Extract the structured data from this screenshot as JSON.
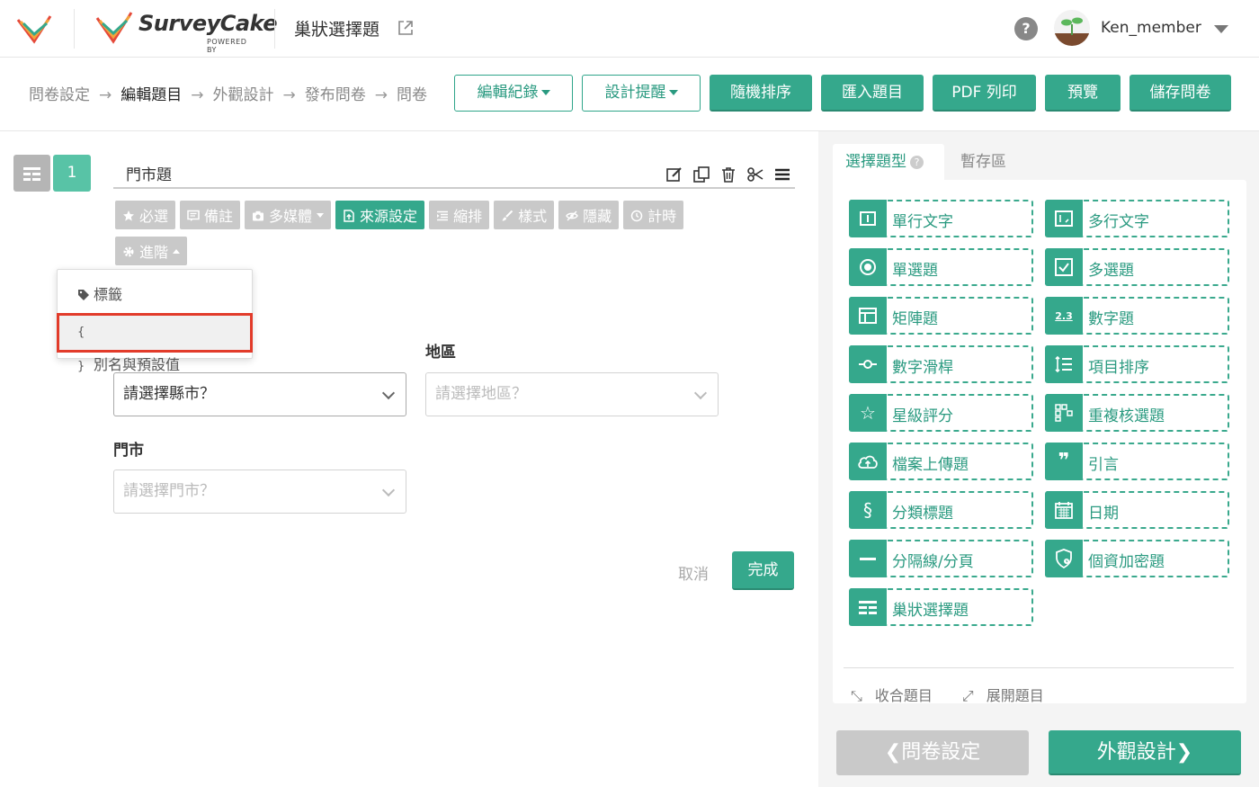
{
  "header": {
    "brand_name": "SurveyCake",
    "brand_powered": "POWERED BY",
    "survey_title": "巢狀選擇題",
    "help_symbol": "?",
    "username": "Ken_member"
  },
  "breadcrumbs": [
    "問卷設定",
    "編輯題目",
    "外觀設計",
    "發布問卷",
    "問卷"
  ],
  "breadcrumb_arrow": "→",
  "toolbar": {
    "edit_log": "編輯紀錄",
    "design_tips": "設計提醒",
    "random_order": "隨機排序",
    "import_questions": "匯入題目",
    "pdf_print": "PDF 列印",
    "preview": "預覽",
    "save_survey": "儲存問卷"
  },
  "question": {
    "number": "1",
    "title": "門市題",
    "options": [
      {
        "label": "必選",
        "icon": "star-icon",
        "active": false
      },
      {
        "label": "備註",
        "icon": "comment-icon",
        "active": false
      },
      {
        "label": "多媒體",
        "icon": "camera-icon",
        "active": false
      },
      {
        "label": "來源設定",
        "icon": "upload-icon",
        "active": true
      },
      {
        "label": "縮排",
        "icon": "indent-icon",
        "active": false
      },
      {
        "label": "樣式",
        "icon": "brush-icon",
        "active": false
      },
      {
        "label": "隱藏",
        "icon": "eye-slash-icon",
        "active": false
      },
      {
        "label": "計時",
        "icon": "clock-icon",
        "active": false
      }
    ],
    "advanced_label": "進階",
    "advanced_menu": [
      {
        "label": "標籤",
        "icon": "tag-icon"
      },
      {
        "label": "別名與預設值",
        "icon": "braces-icon",
        "icon_text": "{ }"
      }
    ],
    "fields": [
      {
        "label": "",
        "placeholder": "請選擇縣市？"
      },
      {
        "label": "地區",
        "placeholder": "請選擇地區？"
      },
      {
        "label": "門市",
        "placeholder": "請選擇門市？"
      }
    ],
    "cancel": "取消",
    "done": "完成"
  },
  "right_panel": {
    "tab_types": "選擇題型",
    "tab_types_help": "?",
    "tab_storage": "暫存區",
    "types": [
      {
        "label": "單行文字",
        "icon": "single-line-text-icon"
      },
      {
        "label": "多行文字",
        "icon": "multi-line-text-icon"
      },
      {
        "label": "單選題",
        "icon": "radio-icon"
      },
      {
        "label": "多選題",
        "icon": "checkbox-icon"
      },
      {
        "label": "矩陣題",
        "icon": "matrix-icon"
      },
      {
        "label": "數字題",
        "icon": "number-icon",
        "icon_text": "2.3"
      },
      {
        "label": "數字滑桿",
        "icon": "slider-icon"
      },
      {
        "label": "項目排序",
        "icon": "sort-list-icon"
      },
      {
        "label": "星級評分",
        "icon": "star-rating-icon",
        "icon_text": "☆"
      },
      {
        "label": "重複核選題",
        "icon": "repeat-check-icon"
      },
      {
        "label": "檔案上傳題",
        "icon": "cloud-upload-icon"
      },
      {
        "label": "引言",
        "icon": "quote-icon",
        "icon_text": "❞"
      },
      {
        "label": "分類標題",
        "icon": "section-icon",
        "icon_text": "§"
      },
      {
        "label": "日期",
        "icon": "calendar-icon"
      },
      {
        "label": "分隔線/分頁",
        "icon": "divider-icon"
      },
      {
        "label": "個資加密題",
        "icon": "privacy-shield-icon"
      },
      {
        "label": "巢狀選擇題",
        "icon": "nested-select-icon"
      }
    ],
    "collapse_all": "收合題目",
    "expand_all": "展開題目"
  },
  "footer_nav": {
    "prev": "問卷設定",
    "next": "外觀設計"
  },
  "colors": {
    "accent": "#35a88c",
    "accent_light": "#58c3a6",
    "disabled": "#c9c9c9",
    "highlight_border": "#e23b2a"
  }
}
